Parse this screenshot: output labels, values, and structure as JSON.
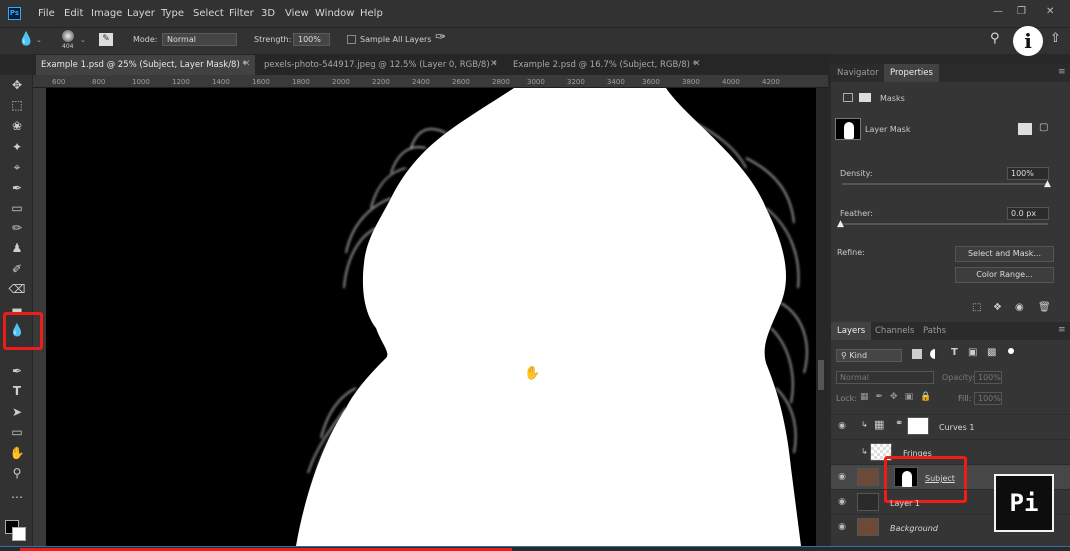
{
  "menu": [
    "File",
    "Edit",
    "Image",
    "Layer",
    "Type",
    "Select",
    "Filter",
    "3D",
    "View",
    "Window",
    "Help"
  ],
  "app_logo": "Ps",
  "options_bar": {
    "brush_size": "404",
    "mode_label": "Mode:",
    "mode_value": "Normal",
    "strength_label": "Strength:",
    "strength_value": "100%",
    "sample_all_layers": "Sample All Layers"
  },
  "info_button": "i",
  "tabs": [
    {
      "label": "Example 1.psd @ 25% (Subject, Layer Mask/8) *",
      "active": true
    },
    {
      "label": "pexels-photo-544917.jpeg @ 12.5% (Layer 0, RGB/8) *",
      "active": false
    },
    {
      "label": "Example 2.psd @ 16.7% (Subject, RGB/8) *",
      "active": false
    }
  ],
  "ruler_ticks": [
    "600",
    "800",
    "1000",
    "1200",
    "1400",
    "1600",
    "1800",
    "2000",
    "2200",
    "2400",
    "2600",
    "2800",
    "3000",
    "3200",
    "3400",
    "3600",
    "3800",
    "4000",
    "4200"
  ],
  "properties": {
    "tab_navigator": "Navigator",
    "tab_properties": "Properties",
    "section": "Masks",
    "mask_type": "Layer Mask",
    "density_label": "Density:",
    "density_value": "100%",
    "feather_label": "Feather:",
    "feather_value": "0.0 px",
    "refine_label": "Refine:",
    "select_and_mask": "Select and Mask...",
    "color_range": "Color Range..."
  },
  "layers": {
    "tab_layers": "Layers",
    "tab_channels": "Channels",
    "tab_paths": "Paths",
    "filter_kind": "Kind",
    "blend_mode": "Normal",
    "opacity_label": "Opacity:",
    "opacity_value": "100%",
    "lock_label": "Lock:",
    "fill_label": "Fill:",
    "fill_value": "100%",
    "items": [
      {
        "name": "Curves 1"
      },
      {
        "name": "Fringes"
      },
      {
        "name": "Subject"
      },
      {
        "name": "Layer 1"
      },
      {
        "name": "Background"
      }
    ]
  },
  "colors": {
    "highlight": "#ef1c1c",
    "panel_bg": "#353535",
    "canvas_bg": "#000000",
    "accent_blue": "#31a8ff"
  },
  "watermark": "Pi"
}
